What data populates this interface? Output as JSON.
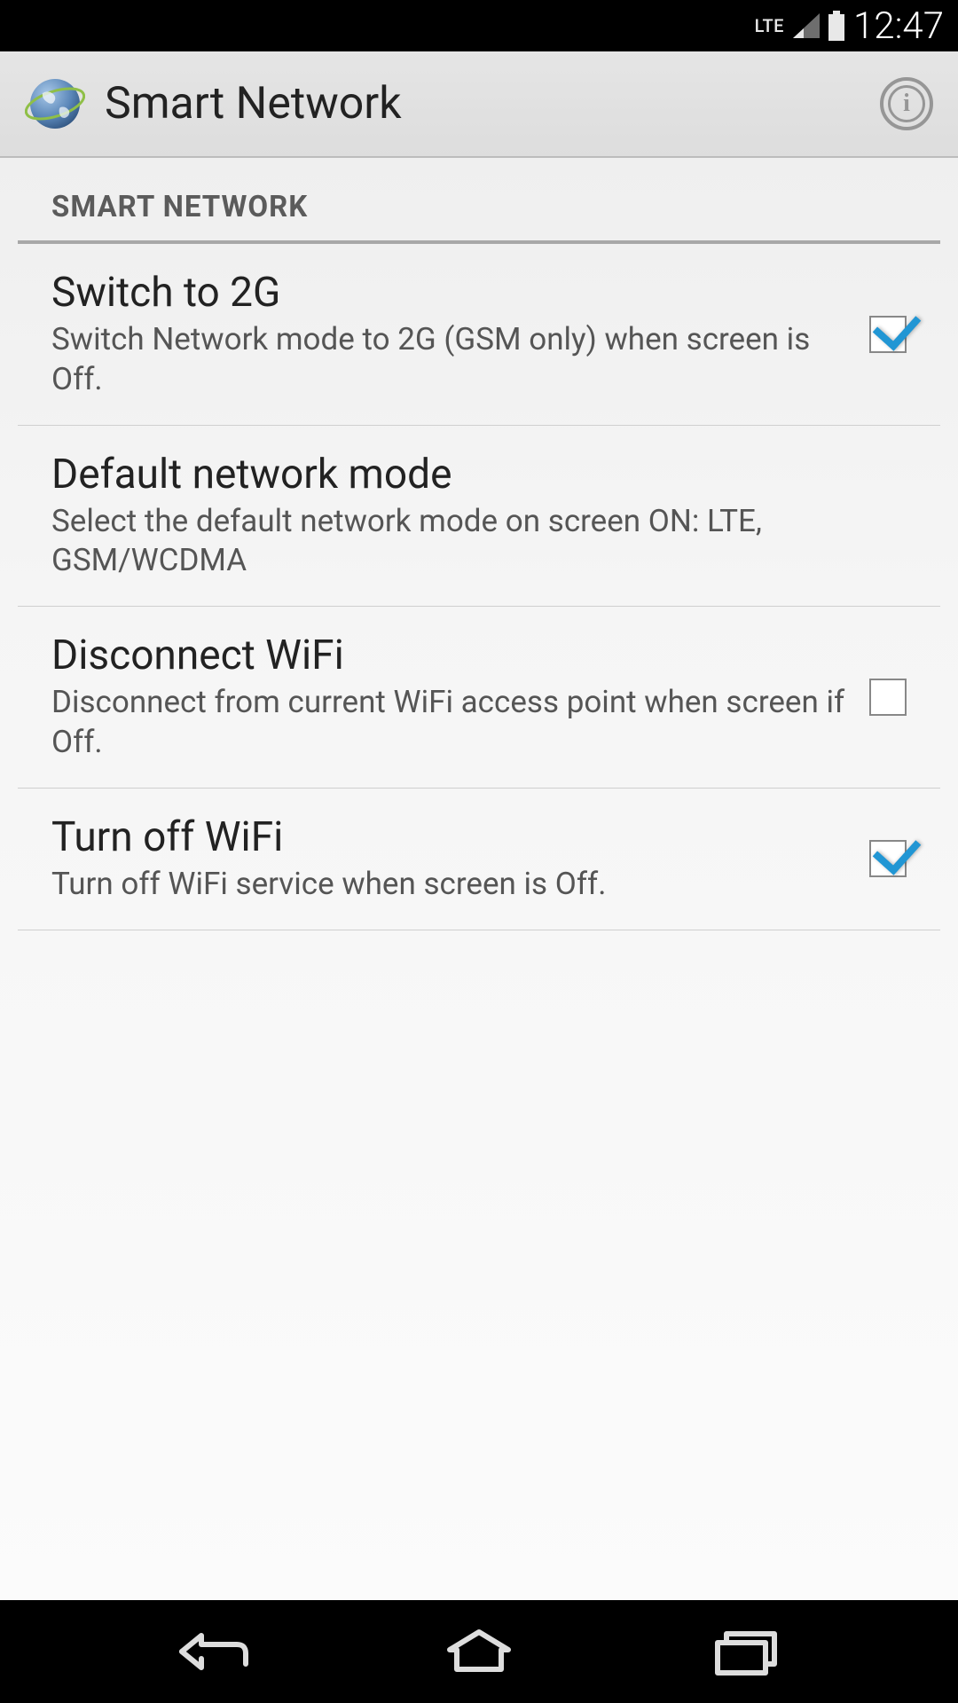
{
  "status_bar": {
    "network_label": "LTE",
    "clock": "12:47"
  },
  "app_bar": {
    "title": "Smart Network"
  },
  "section": {
    "header": "SMART NETWORK",
    "items": [
      {
        "title": "Switch to 2G",
        "subtitle": "Switch Network mode to 2G (GSM only) when screen is Off.",
        "has_checkbox": true,
        "checked": true
      },
      {
        "title": "Default network mode",
        "subtitle": "Select the default network mode on screen ON: LTE, GSM/WCDMA",
        "has_checkbox": false,
        "checked": false
      },
      {
        "title": "Disconnect WiFi",
        "subtitle": "Disconnect from current WiFi access point when screen if Off.",
        "has_checkbox": true,
        "checked": false
      },
      {
        "title": "Turn off WiFi",
        "subtitle": "Turn off WiFi service when screen is Off.",
        "has_checkbox": true,
        "checked": true
      }
    ]
  }
}
